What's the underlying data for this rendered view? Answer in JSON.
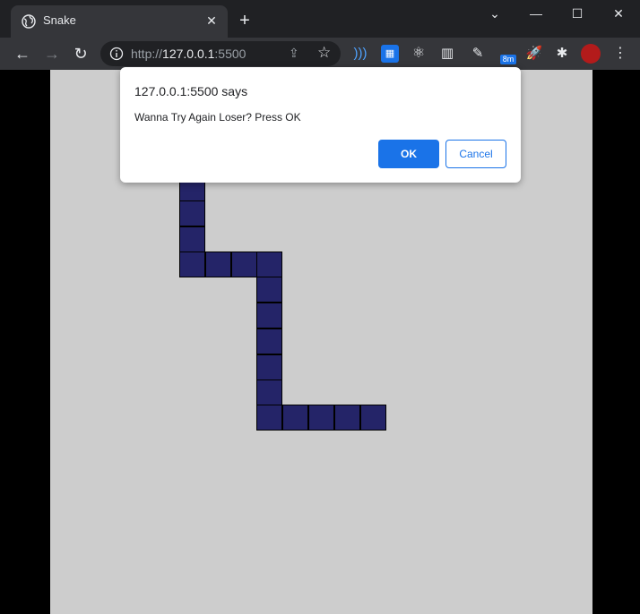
{
  "browser": {
    "tab_title": "Snake",
    "tab_icon": "globe-icon",
    "new_tab_symbol": "+",
    "close_symbol": "✕",
    "window_controls": {
      "dropdown": "⌄",
      "minimize": "—",
      "maximize": "☐",
      "close": "✕"
    },
    "url_prefix": "http://",
    "url_host": "127.0.0.1",
    "url_port": ":5500",
    "extension_badge": "8m",
    "colors": {
      "tab_bar": "#202124",
      "toolbar": "#35363a",
      "accent": "#1a73e8"
    }
  },
  "dialog": {
    "title": "127.0.0.1:5500 says",
    "message": "Wanna Try Again Loser? Press OK",
    "ok_label": "OK",
    "cancel_label": "Cancel"
  },
  "game": {
    "background_color": "#cdcdcd",
    "snake_color": "#242468",
    "snake_segment_count": 18
  }
}
